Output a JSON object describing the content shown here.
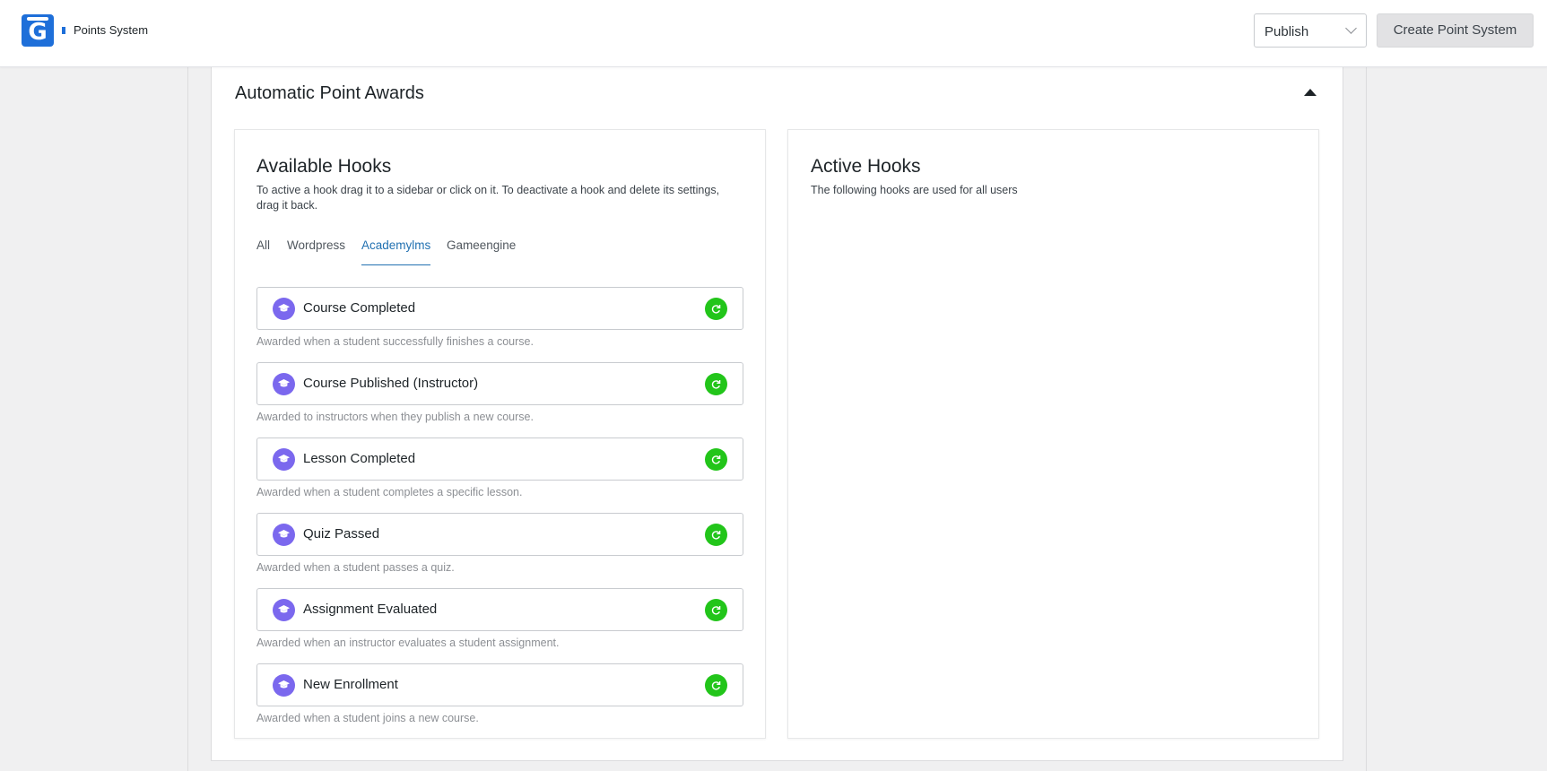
{
  "header": {
    "breadcrumb": "Points System",
    "publish_select": {
      "selected": "Publish",
      "icon": "chevron-down-icon"
    },
    "create_button": "Create Point System"
  },
  "section": {
    "title": "Automatic Point Awards",
    "collapse_icon": "caret-up-icon"
  },
  "available": {
    "title": "Available Hooks",
    "description": "To active a hook drag it to a sidebar or click on it. To deactivate a hook and delete its settings, drag it back.",
    "tabs": [
      {
        "label": "All",
        "active": false
      },
      {
        "label": "Wordpress",
        "active": false
      },
      {
        "label": "Academylms",
        "active": true
      },
      {
        "label": "Gameengine",
        "active": false
      }
    ],
    "hooks": [
      {
        "name": "Course Completed",
        "description": "Awarded when a student successfully finishes a course."
      },
      {
        "name": "Course Published (Instructor)",
        "description": "Awarded to instructors when they publish a new course."
      },
      {
        "name": "Lesson Completed",
        "description": "Awarded when a student completes a specific lesson."
      },
      {
        "name": "Quiz Passed",
        "description": "Awarded when a student passes a quiz."
      },
      {
        "name": "Assignment Evaluated",
        "description": "Awarded when an instructor evaluates a student assignment."
      },
      {
        "name": "New Enrollment",
        "description": "Awarded when a student joins a new course."
      }
    ],
    "hook_icon": "graduation-cap-icon",
    "activate_icon": "redo-arrow-icon",
    "colors": {
      "hook_icon_bg": "#7b68ee",
      "activate_bg": "#22c51a",
      "accent": "#2271b1"
    }
  },
  "active": {
    "title": "Active Hooks",
    "description": "The following hooks are used for all users"
  }
}
